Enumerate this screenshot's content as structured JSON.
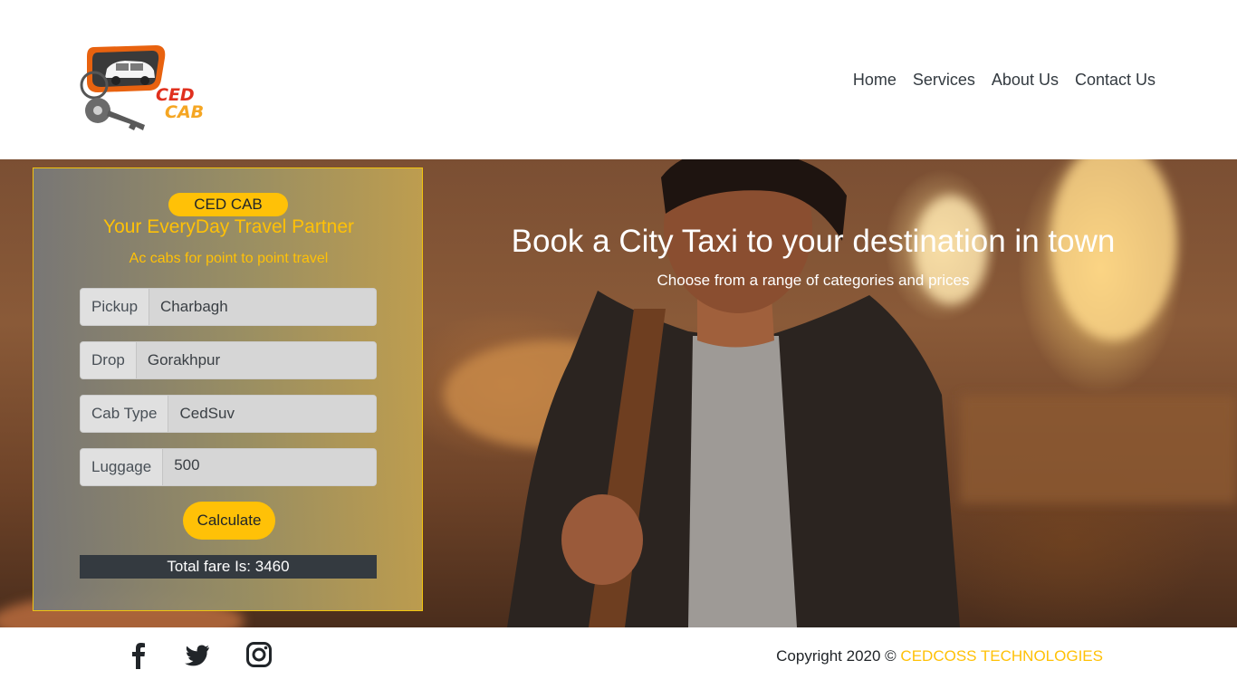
{
  "brand": {
    "logo_line1": "CED",
    "logo_line2": "CAB"
  },
  "nav": {
    "items": [
      "Home",
      "Services",
      "About Us",
      "Contact Us"
    ]
  },
  "hero": {
    "title": "Book a City Taxi to your destination in town",
    "subtitle": "Choose from a range of categories and prices"
  },
  "booking": {
    "badge": "CED CAB",
    "title": "Your EveryDay Travel Partner",
    "subtitle": "Ac cabs for point to point travel",
    "fields": [
      {
        "label": "Pickup",
        "value": "Charbagh"
      },
      {
        "label": "Drop",
        "value": "Gorakhpur"
      },
      {
        "label": "Cab Type",
        "value": "CedSuv"
      },
      {
        "label": "Luggage",
        "value": "500"
      }
    ],
    "calculate_label": "Calculate",
    "total": "Total fare Is: 3460"
  },
  "footer": {
    "social_icons": [
      "facebook-icon",
      "twitter-icon",
      "instagram-icon"
    ],
    "copyright_prefix": "Copyright 2020 ©",
    "copyright_brand": "CEDCOSS TECHNOLOGIES"
  },
  "colors": {
    "accent": "#ffc107",
    "dark": "#343a40",
    "nav_text": "#333a40"
  }
}
